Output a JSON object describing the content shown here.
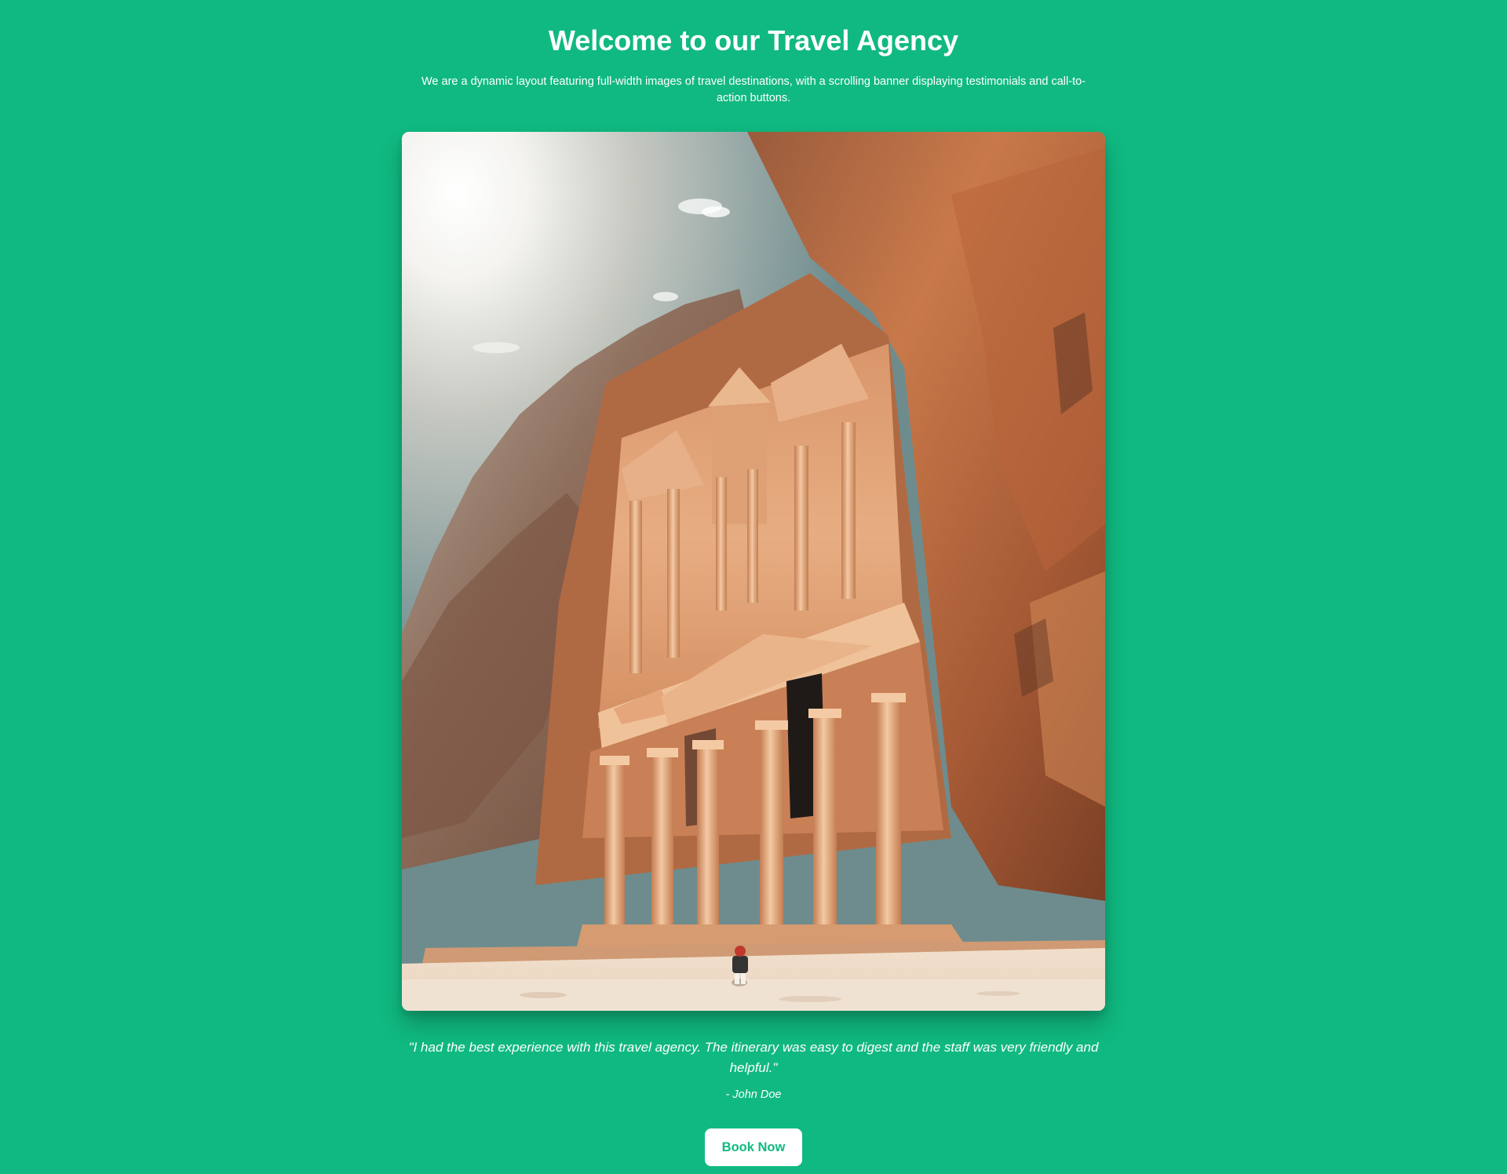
{
  "header": {
    "title": "Welcome to our Travel Agency",
    "intro": "We are a dynamic layout featuring full-width images of travel destinations, with a scrolling banner displaying testimonials and call-to-action buttons."
  },
  "testimonial": {
    "quote": "\"I had the best experience with this travel agency. The itinerary was easy to digest and the staff was very friendly and helpful.\"",
    "author": "- John Doe"
  },
  "cta": {
    "label": "Book Now"
  },
  "colors": {
    "background": "#10b981",
    "text": "#ffffff",
    "button_bg": "#ffffff",
    "button_text": "#10b981"
  }
}
